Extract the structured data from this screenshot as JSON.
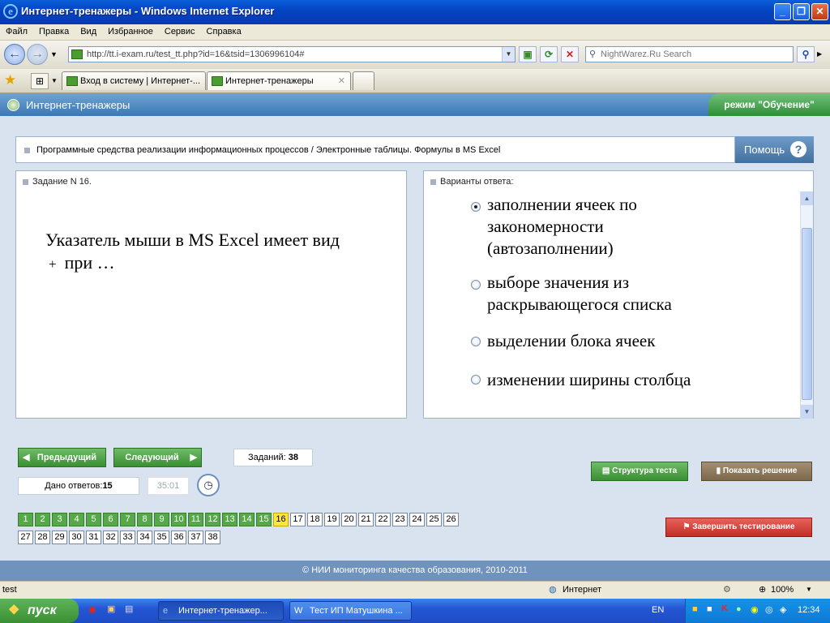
{
  "window": {
    "title": "Интернет-тренажеры - Windows Internet Explorer"
  },
  "menu": [
    "Файл",
    "Правка",
    "Вид",
    "Избранное",
    "Сервис",
    "Справка"
  ],
  "address": {
    "url": "http://tt.i-exam.ru/test_tt.php?id=16&tsid=1306996104#",
    "search_placeholder": "NightWarez.Ru Search"
  },
  "tabs": [
    {
      "label": "Вход в систему | Интернет-..."
    },
    {
      "label": "Интернет-тренажеры"
    }
  ],
  "app": {
    "name": "Интернет-тренажеры",
    "mode": "режим \"Обучение\""
  },
  "breadcrumb": "Программные средства реализации информационных процессов / Электронные таблицы. Формулы в MS Excel",
  "help_label": "Помощь",
  "task": {
    "header": "Задание N 16.",
    "line1": "Указатель мыши в MS Excel имеет вид",
    "glyph": "+",
    "line2": "при …"
  },
  "answers": {
    "header": "Варианты ответа:",
    "options": [
      {
        "line1": "заполнении ячеек по",
        "line2": "закономерности",
        "line3": "(автозаполнении)",
        "selected": true
      },
      {
        "line1": "выборе значения из",
        "line2": "раскрывающегося списка",
        "selected": false
      },
      {
        "line1": "выделении блока ячеек",
        "selected": false
      },
      {
        "line1": "изменении ширины столбца",
        "selected": false
      }
    ]
  },
  "nav": {
    "prev": "Предыдущий",
    "next": "Следующий"
  },
  "stats": {
    "tasks_label": "Заданий:",
    "tasks_value": "38",
    "answered_label": "Дано ответов:",
    "answered_value": "15",
    "timer": "35:01"
  },
  "actions": {
    "structure": "Структура теста",
    "show_solution": "Показать решение",
    "finish": "Завершить тестирование"
  },
  "questions": {
    "total": 38,
    "answered": 15,
    "current": 16
  },
  "footer": "© НИИ мониторинга качества образования, 2010-2011",
  "status": {
    "text": "test",
    "zone": "Интернет",
    "zoom": "100%"
  },
  "taskbar": {
    "start": "пуск",
    "tasks": [
      "Интернет-тренажер...",
      "Тест ИП Матушкина ..."
    ],
    "lang": "EN",
    "clock": "12:34"
  }
}
